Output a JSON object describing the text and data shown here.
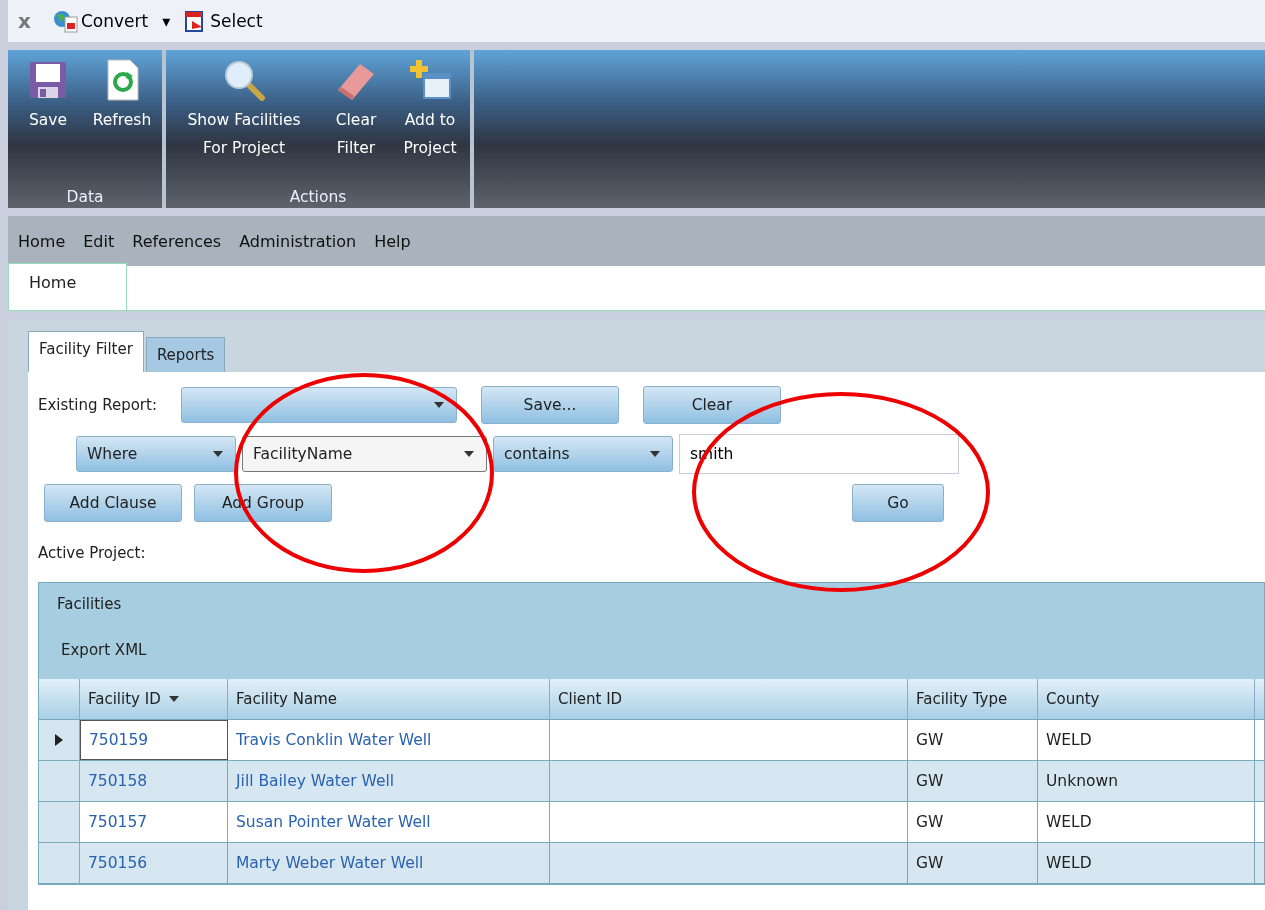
{
  "toolbar": [
    {
      "kind": "close",
      "label": "x"
    },
    {
      "kind": "convert",
      "label": "Convert"
    },
    {
      "kind": "caret",
      "label": "▾"
    },
    {
      "kind": "select",
      "label": "Select"
    }
  ],
  "ribbon": [
    {
      "group": "Data",
      "buttons": [
        {
          "kind": "save",
          "label": "Save"
        },
        {
          "kind": "refresh",
          "label": "Refresh"
        }
      ]
    },
    {
      "group": "Actions",
      "buttons": [
        {
          "kind": "search",
          "label": "Show Facilities For Project"
        },
        {
          "kind": "eraser",
          "label": "Clear Filter"
        },
        {
          "kind": "add",
          "label": "Add to Project"
        }
      ]
    }
  ],
  "menu": [
    "Home",
    "Edit",
    "References",
    "Administration",
    "Help"
  ],
  "doc_tabs": [
    {
      "label": "Home",
      "selected": true
    }
  ],
  "filter_tabs": [
    {
      "label": "Facility Filter",
      "selected": true
    },
    {
      "label": "Reports",
      "selected": false
    }
  ],
  "existing_report": {
    "label": "Existing Report:",
    "buttons": [
      "Save...",
      "Clear"
    ]
  },
  "clause": {
    "joiner": "Where",
    "field": "FacilityName",
    "operator": "contains",
    "value": "smith"
  },
  "clause_buttons": [
    "Add Clause",
    "Add Group"
  ],
  "go_button": "Go",
  "active_project_label": "Active Project:",
  "grid": {
    "title": "Facilities",
    "export": "Export XML",
    "columns": [
      {
        "label": "Facility ID",
        "sorted": true
      },
      {
        "label": "Facility Name",
        "sorted": false
      },
      {
        "label": "Client ID",
        "sorted": false
      },
      {
        "label": "Facility Type",
        "sorted": false
      },
      {
        "label": "County",
        "sorted": false
      }
    ],
    "rows": [
      {
        "selected": true,
        "cells": [
          "750159",
          "Travis Conklin Water Well",
          "",
          "GW",
          "WELD"
        ]
      },
      {
        "selected": false,
        "cells": [
          "750158",
          "Jill Bailey Water Well",
          "",
          "GW",
          "Unknown"
        ]
      },
      {
        "selected": false,
        "cells": [
          "750157",
          "Susan Pointer Water Well",
          "",
          "GW",
          "WELD"
        ]
      },
      {
        "selected": false,
        "cells": [
          "750156",
          "Marty Weber Water Well",
          "",
          "GW",
          "WELD"
        ]
      }
    ]
  }
}
